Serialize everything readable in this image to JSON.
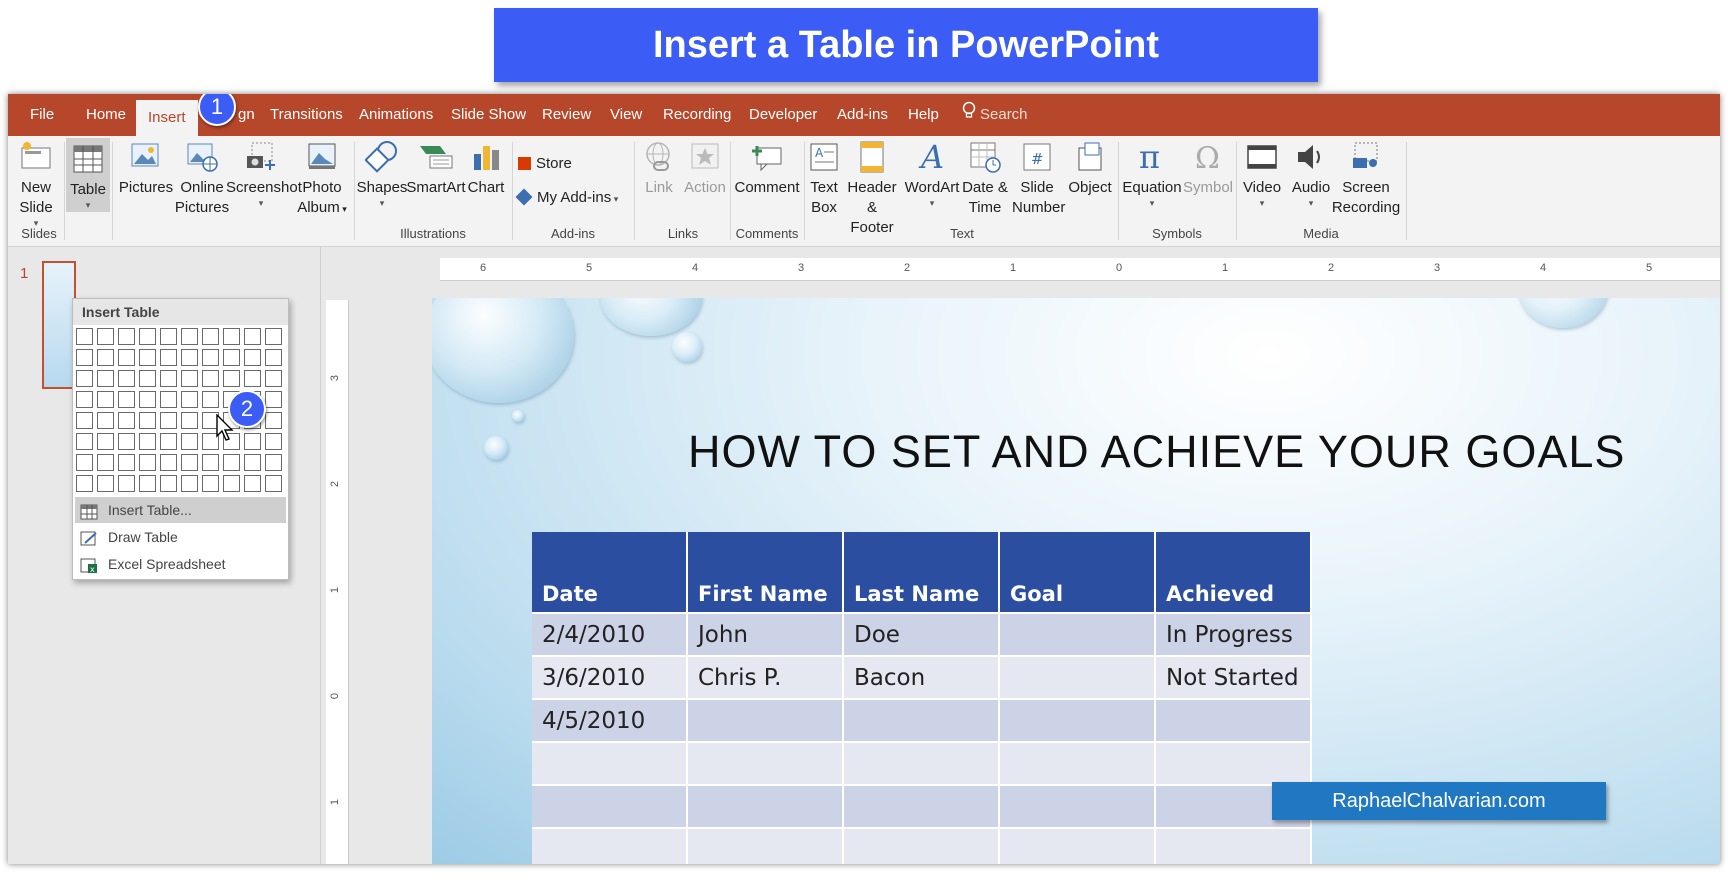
{
  "banner": {
    "title": "Insert a Table in PowerPoint"
  },
  "tabs": [
    "File",
    "Home",
    "Insert",
    "gn",
    "Transitions",
    "Animations",
    "Slide Show",
    "Review",
    "View",
    "Recording",
    "Developer",
    "Add-ins",
    "Help"
  ],
  "search": {
    "label": "Search"
  },
  "ribbon": {
    "new_slide": [
      "New",
      "Slide"
    ],
    "table": "Table",
    "pictures": "Pictures",
    "online_pictures": [
      "Online",
      "Pictures"
    ],
    "screenshot": "Screenshot",
    "photo_album": [
      "Photo",
      "Album"
    ],
    "shapes": "Shapes",
    "smartart": "SmartArt",
    "chart": "Chart",
    "store": "Store",
    "my_addins": "My Add-ins",
    "link": "Link",
    "action": "Action",
    "comment": "Comment",
    "text_box": [
      "Text",
      "Box"
    ],
    "header_footer": [
      "Header",
      "& Footer"
    ],
    "wordart": "WordArt",
    "date_time": [
      "Date &",
      "Time"
    ],
    "slide_number": [
      "Slide",
      "Number"
    ],
    "object": "Object",
    "equation": "Equation",
    "symbol": "Symbol",
    "video": "Video",
    "audio": "Audio",
    "screen_recording": [
      "Screen",
      "Recording"
    ],
    "groups": {
      "slides": "Slides",
      "illustrations": "Illustrations",
      "addins": "Add-ins",
      "links": "Links",
      "comments": "Comments",
      "text": "Text",
      "symbols": "Symbols",
      "media": "Media"
    }
  },
  "dropdown": {
    "header": "Insert Table",
    "grid": {
      "cols": 10,
      "rows": 8
    },
    "items": [
      "Insert Table...",
      "Draw Table",
      "Excel Spreadsheet"
    ]
  },
  "thumbnail": {
    "number": "1"
  },
  "rulers": {
    "horizontal": [
      "6",
      "5",
      "4",
      "3",
      "2",
      "1",
      "0",
      "1",
      "2",
      "3",
      "4",
      "5"
    ],
    "vertical": [
      "3",
      "2",
      "1",
      "0",
      "1"
    ]
  },
  "slide": {
    "title": "HOW TO SET AND ACHIEVE YOUR GOALS",
    "table": {
      "headers": [
        "Date",
        "First Name",
        "Last Name",
        "Goal",
        "Achieved"
      ],
      "rows": [
        [
          "2/4/2010",
          "John",
          "Doe",
          "",
          "In Progress"
        ],
        [
          "3/6/2010",
          "Chris P.",
          "Bacon",
          "",
          "Not Started"
        ],
        [
          "4/5/2010",
          "",
          "",
          "",
          ""
        ],
        [
          "",
          "",
          "",
          "",
          ""
        ],
        [
          "",
          "",
          "",
          "",
          ""
        ],
        [
          "",
          "",
          "",
          "",
          ""
        ]
      ]
    },
    "watermark": "RaphaelChalvarian.com"
  },
  "badges": [
    "1",
    "2"
  ],
  "colors": {
    "accent": "#b7472a",
    "banner": "#3b5cf5",
    "table_header": "#2b4ea0",
    "watermark": "#1f78c1"
  }
}
